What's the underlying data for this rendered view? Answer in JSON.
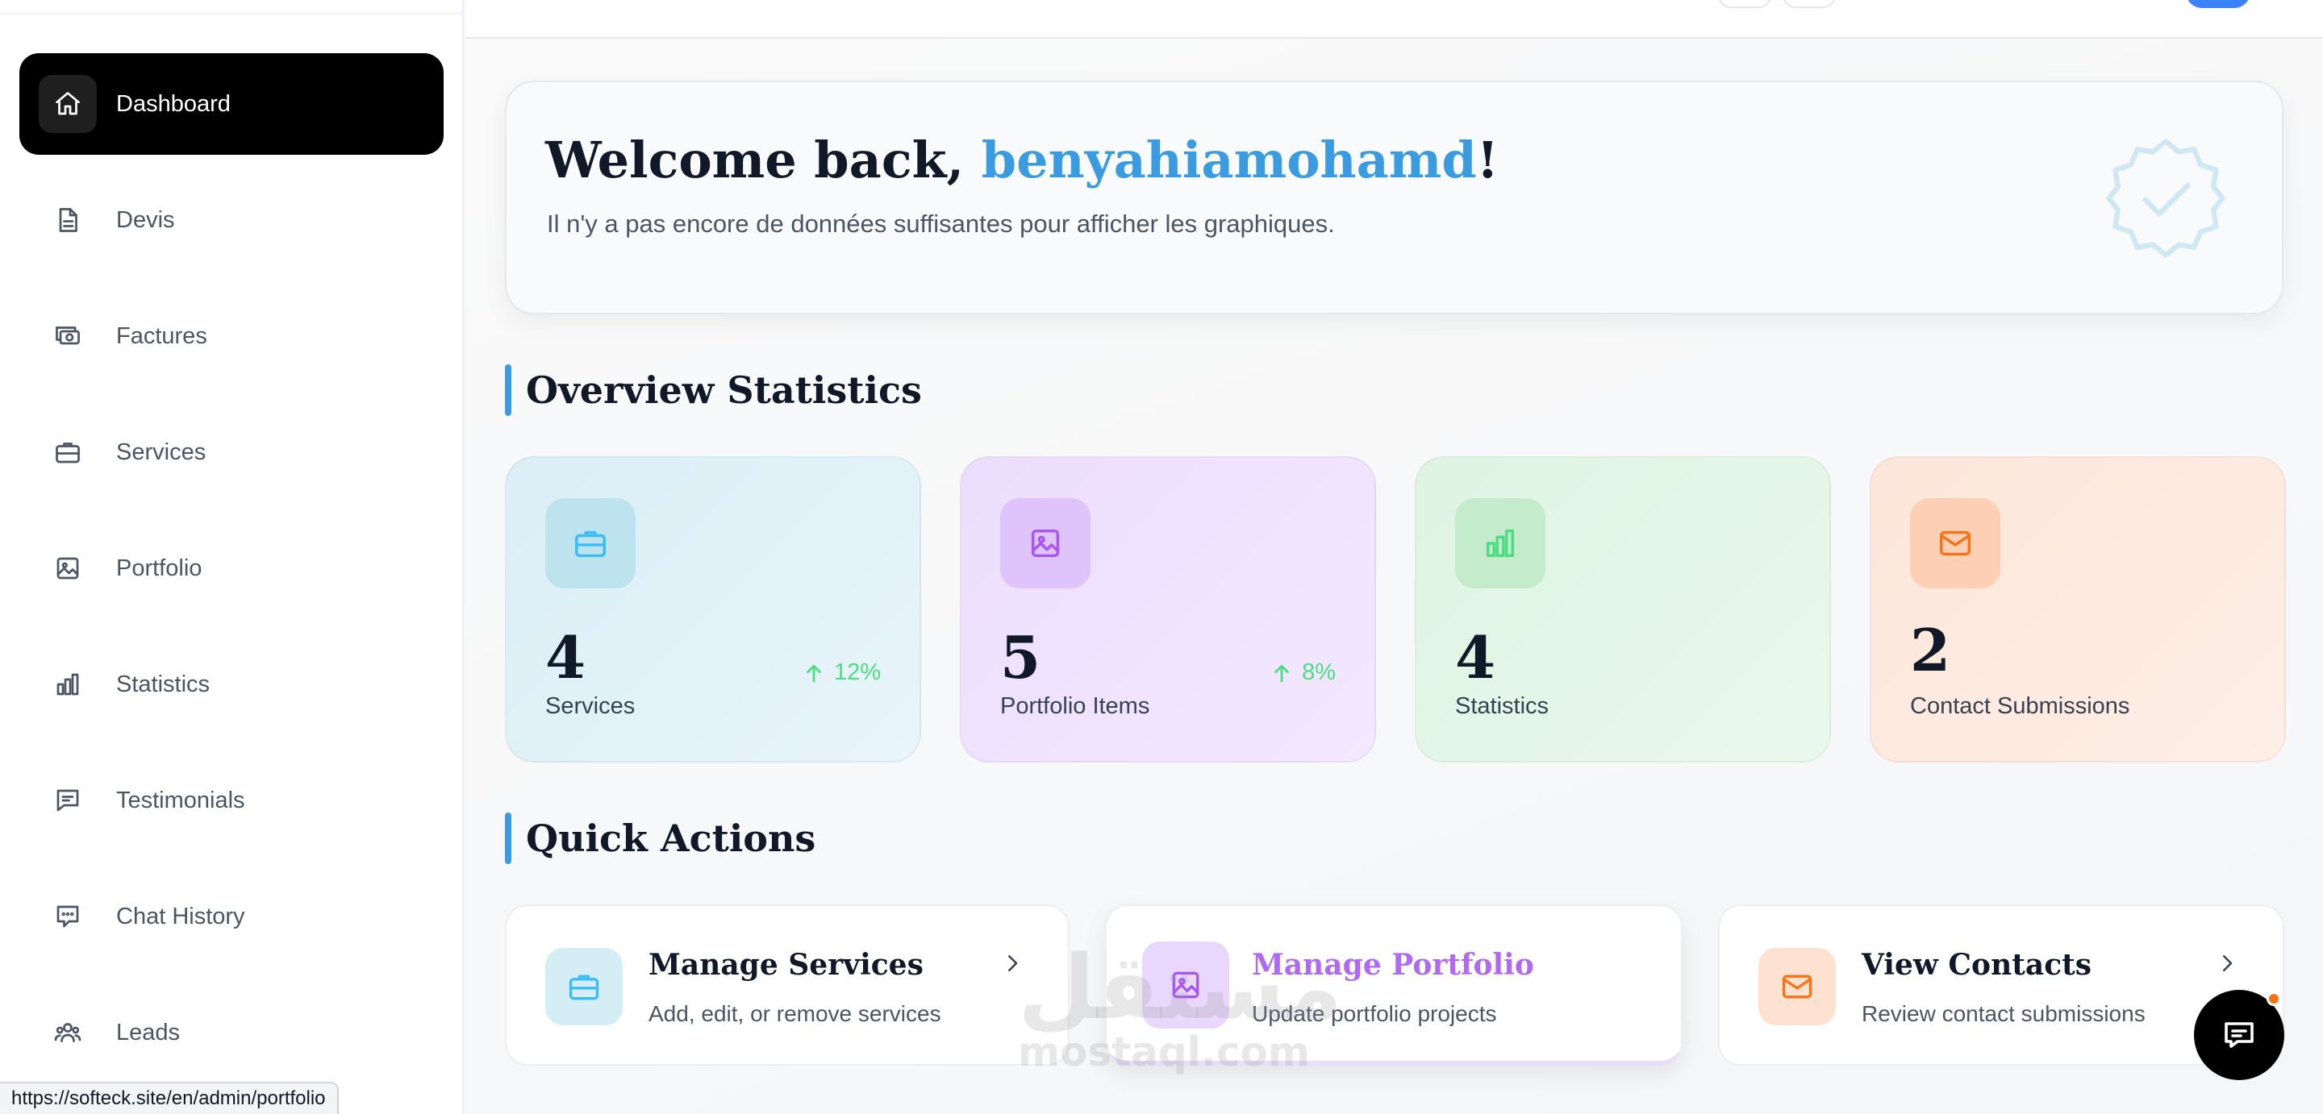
{
  "sidebar": {
    "items": [
      {
        "label": "Dashboard",
        "icon": "home-icon",
        "active": true
      },
      {
        "label": "Devis",
        "icon": "document-icon"
      },
      {
        "label": "Factures",
        "icon": "money-icon"
      },
      {
        "label": "Services",
        "icon": "briefcase-icon"
      },
      {
        "label": "Portfolio",
        "icon": "image-icon"
      },
      {
        "label": "Statistics",
        "icon": "bar-chart-icon"
      },
      {
        "label": "Testimonials",
        "icon": "message-icon"
      },
      {
        "label": "Chat History",
        "icon": "chat-icon"
      },
      {
        "label": "Leads",
        "icon": "users-icon"
      }
    ]
  },
  "welcome": {
    "prefix": "Welcome back, ",
    "username": "benyahiamohamd",
    "suffix": "!",
    "subtitle": "Il n'y a pas encore de données suffisantes pour afficher les graphiques."
  },
  "overview": {
    "title": "Overview Statistics",
    "cards": [
      {
        "value": "4",
        "label": "Services",
        "trend": "12%",
        "icon": "briefcase-icon",
        "color": "#38bdf8"
      },
      {
        "value": "5",
        "label": "Portfolio Items",
        "trend": "8%",
        "icon": "image-icon",
        "color": "#a855f7"
      },
      {
        "value": "4",
        "label": "Statistics",
        "icon": "bar-chart-icon",
        "color": "#4ade80"
      },
      {
        "value": "2",
        "label": "Contact Submissions",
        "icon": "mail-icon",
        "color": "#f97316"
      }
    ]
  },
  "quick_actions": {
    "title": "Quick Actions",
    "items": [
      {
        "title": "Manage Services",
        "desc": "Add, edit, or remove services",
        "icon": "briefcase-icon"
      },
      {
        "title": "Manage Portfolio",
        "desc": "Update portfolio projects",
        "icon": "image-icon"
      },
      {
        "title": "View Contacts",
        "desc": "Review contact submissions",
        "icon": "mail-icon"
      }
    ]
  },
  "status_bar": {
    "url": "https://softeck.site/en/admin/portfolio"
  },
  "watermark": {
    "arabic": "مستقل",
    "latin": "mostaql.com"
  },
  "colors": {
    "accent": "#3b9be0",
    "active_nav": "#000000",
    "trend_up": "#4ade80"
  }
}
